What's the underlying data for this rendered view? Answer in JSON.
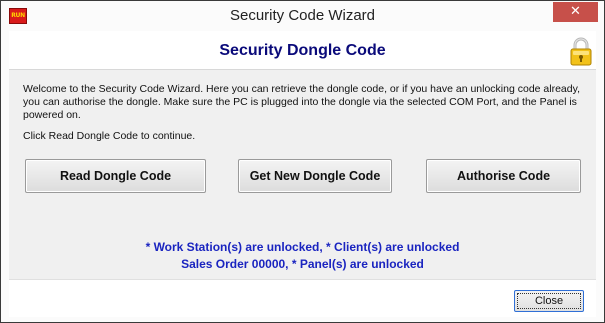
{
  "window": {
    "title": "Security Code Wizard",
    "app_icon_label": "RUN",
    "close_glyph": "✕",
    "close_color": "#c7504a"
  },
  "header": {
    "title": "Security Dongle Code",
    "icon": "lock-icon"
  },
  "body": {
    "intro": "Welcome to the Security Code Wizard. Here you can retrieve the dongle code, or if you have an unlocking code already, you can authorise the dongle. Make sure the PC is plugged into the dongle via the selected COM Port, and the Panel is powered on.",
    "instruction": "Click Read Dongle Code to continue."
  },
  "buttons": {
    "read": "Read Dongle Code",
    "get": "Get New Dongle Code",
    "authorise": "Authorise Code"
  },
  "status": {
    "line1": "* Work Station(s) are unlocked, * Client(s) are unlocked",
    "line2": "Sales Order 00000, * Panel(s) are unlocked",
    "color": "#1a24c0"
  },
  "footer": {
    "close_label": "Close"
  }
}
